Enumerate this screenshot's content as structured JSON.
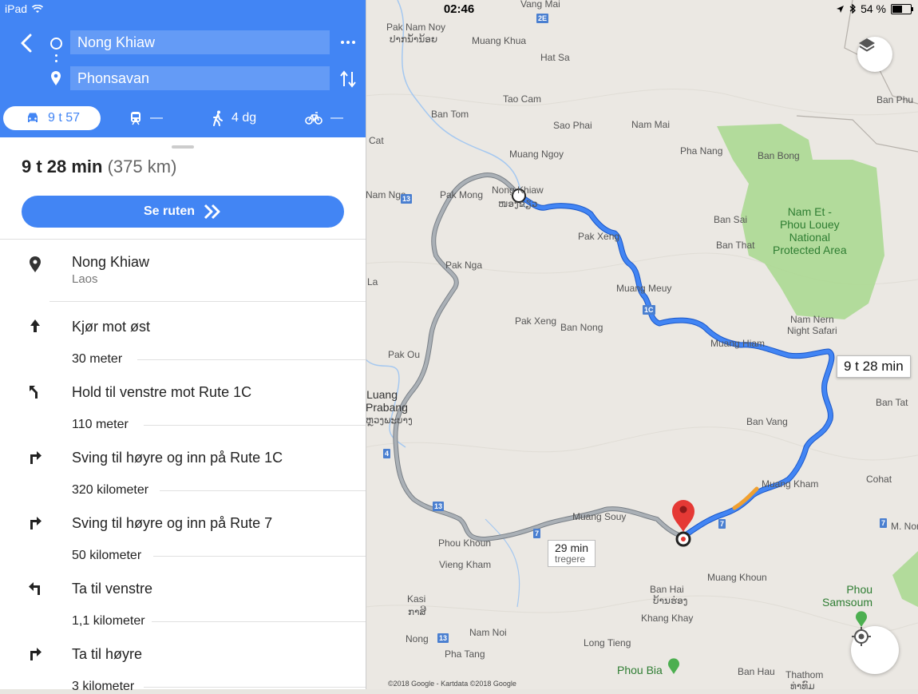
{
  "status": {
    "device": "iPad",
    "time": "02:46",
    "battery": "54 %"
  },
  "header": {
    "origin": "Nong Khiaw",
    "destination": "Phonsavan",
    "modes": [
      {
        "icon": "car-icon",
        "value": "9 t 57"
      },
      {
        "icon": "train-icon",
        "value": "—"
      },
      {
        "icon": "walk-icon",
        "value": "4 dg"
      },
      {
        "icon": "bike-icon",
        "value": "—"
      }
    ]
  },
  "summary": {
    "duration": "9 t 28 min",
    "distance": "(375 km)",
    "button": "Se ruten"
  },
  "steps": [
    {
      "icon": "location-pin-icon",
      "text": "Nong Khiaw",
      "sub": "Laos"
    },
    {
      "icon": "arrow-up-icon",
      "text": "Kjør mot øst",
      "distance": "30 meter"
    },
    {
      "icon": "turn-slight-left-icon",
      "text": "Hold til venstre mot Rute 1C",
      "distance": "110 meter"
    },
    {
      "icon": "turn-right-icon",
      "text": "Sving til høyre og inn på Rute 1C",
      "distance": "320 kilometer"
    },
    {
      "icon": "turn-right-icon",
      "text": "Sving til høyre og inn på Rute 7",
      "distance": "50 kilometer"
    },
    {
      "icon": "turn-left-icon",
      "text": "Ta til venstre",
      "distance": "1,1 kilometer"
    },
    {
      "icon": "turn-right-icon",
      "text": "Ta til høyre",
      "distance": "3 kilometer"
    }
  ],
  "map": {
    "route_duration": "9 t 28 min",
    "alt_route": {
      "duration": "29 min",
      "note": "tregere"
    },
    "copyright": "©2018 Google - Kartdata ©2018 Google",
    "labels": [
      "Vang Mai",
      "Pak Nam Noy",
      "ປາກນ້ຳນ້ອຍ",
      "Muang Khua",
      "Hat Sa",
      "Tao Cam",
      "Ban Tom",
      "Sao Phai",
      "Nam Mai",
      "Muang Ngoy",
      "Pha Nang",
      "Ban Bong",
      "Pak Mong",
      "Nong Khiaw",
      "ໜອງຂຽວ",
      "Nam Nga",
      "Pak Xeng",
      "Ban Sai",
      "Ban That",
      "Pak Nga",
      "Muang Meuy",
      "Pak Xeng",
      "Ban Nong",
      "Nam Nern\nNight Safari",
      "Muang Hiam",
      "Pak Ou",
      "Luang\nPrabang",
      "ຫຼວງພະບາງ",
      "Ban Vang",
      "Ban Tat",
      "Muang Kham",
      "Cohat",
      "Muang Souy",
      "Phou Khoun",
      "Vieng Kham",
      "Ban Hai",
      "ບ້ານຮ່ອງ",
      "Muang Khoun",
      "Kasi",
      "ກາສີ",
      "Khang Khay",
      "Nong",
      "Nam Noi",
      "Long Tieng",
      "Pha Tang",
      "Phou Bia",
      "Ban Hau",
      "Thathom",
      "ທ່າທົມ",
      "Phou\nSamsoum",
      "M. Nor",
      "Ban Phu",
      "Cat",
      "La",
      "Nam Et -\nPhou Louey\nNational\nProtected Area"
    ]
  },
  "colors": {
    "header": "#4285f4",
    "route": "#4285f4",
    "alt_route": "#9aa0a6",
    "park": "#a8d88e",
    "traffic": "#f0a030",
    "pin": "#e53935"
  }
}
